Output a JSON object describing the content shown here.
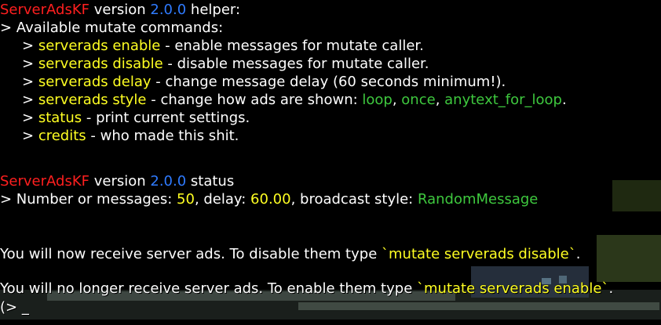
{
  "colors": {
    "plugin_name": "#ff1f1f",
    "version": "#2f7bff",
    "command": "#ffff22",
    "option": "#3ec83e",
    "text": "#ffffff",
    "background": "#000000"
  },
  "help": {
    "plugin": "ServerAdsKF",
    "version_word": " version ",
    "version": "2.0.0",
    "suffix": " helper:",
    "available": "> Available mutate commands:",
    "commands": [
      {
        "arrow": "> ",
        "name": "serverads enable",
        "desc": " - enable messages for mutate caller."
      },
      {
        "arrow": "> ",
        "name": "serverads disable",
        "desc": " - disable messages for mutate caller."
      },
      {
        "arrow": "> ",
        "name": "serverads delay",
        "desc": " - change message delay (60 seconds minimum!)."
      },
      {
        "arrow": "> ",
        "name": "serverads style",
        "desc": " - change how ads are shown: "
      },
      {
        "arrow": "> ",
        "name": "status",
        "desc": " - print current settings."
      },
      {
        "arrow": "> ",
        "name": "credits",
        "desc": " - who made this shit."
      }
    ],
    "style_options": [
      "loop",
      "once",
      "anytext_for_loop"
    ],
    "sep": ", ",
    "end": "."
  },
  "status": {
    "plugin": "ServerAdsKF",
    "version_word": " version ",
    "version": "2.0.0",
    "suffix": " status",
    "prefix": "> Number or messages: ",
    "messages": "50",
    "delay_label": ", delay: ",
    "delay": "60.00",
    "style_label": ", broadcast style: ",
    "style": "RandomMessage"
  },
  "enable_msg": {
    "text": "You will now receive server ads. To disable them type ",
    "command": "`mutate serverads disable`",
    "end": "."
  },
  "disable_msg": {
    "text": "You will no longer receive server ads. To enable them type ",
    "command": "`mutate serverads enable`",
    "end": "."
  },
  "prompt": {
    "text": "(> _"
  }
}
